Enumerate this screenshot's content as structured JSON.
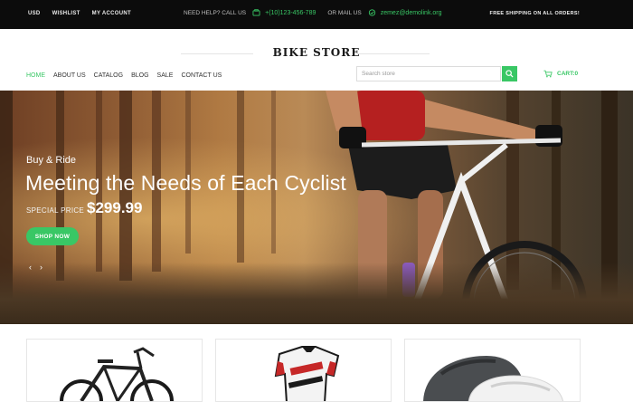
{
  "topbar": {
    "currency": "USD",
    "wishlist": "WISHLIST",
    "account": "MY ACCOUNT",
    "help_label": "NEED HELP? CALL US",
    "phone": "+(10)123-456-789",
    "mail_label": "OR MAIL US",
    "email": "zemez@demolink.org",
    "shipping": "FREE SHIPPING ON ALL ORDERS!"
  },
  "header": {
    "logo": "BIKE STORE",
    "nav": [
      "HOME",
      "ABOUT US",
      "CATALOG",
      "BLOG",
      "SALE",
      "CONTACT US"
    ],
    "search_placeholder": "Search store",
    "cart_label": "CART:0"
  },
  "hero": {
    "kicker": "Buy & Ride",
    "title": "Meeting the Needs of Each Cyclist",
    "price_label": "SPECIAL PRICE",
    "price": "$299.99",
    "button": "SHOP NOW",
    "prev": "‹",
    "next": "›"
  },
  "products": [
    {
      "name": "bike",
      "icon": "bike-icon"
    },
    {
      "name": "jersey",
      "icon": "jersey-icon"
    },
    {
      "name": "helmet",
      "icon": "helmet-icon"
    }
  ],
  "colors": {
    "accent": "#39c765",
    "topbar": "#0c0c0c"
  }
}
